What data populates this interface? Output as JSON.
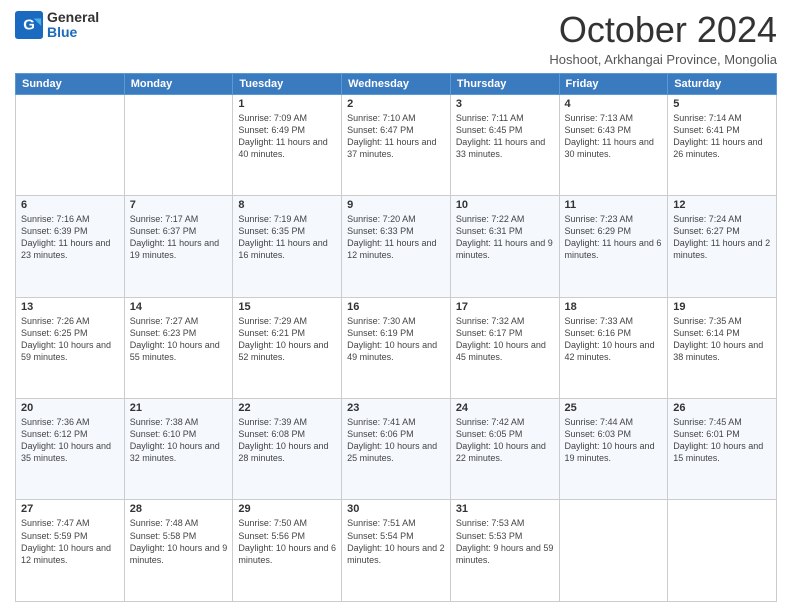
{
  "logo": {
    "general": "General",
    "blue": "Blue"
  },
  "header": {
    "month": "October 2024",
    "location": "Hoshoot, Arkhangai Province, Mongolia"
  },
  "days_of_week": [
    "Sunday",
    "Monday",
    "Tuesday",
    "Wednesday",
    "Thursday",
    "Friday",
    "Saturday"
  ],
  "weeks": [
    [
      {
        "day": "",
        "detail": ""
      },
      {
        "day": "",
        "detail": ""
      },
      {
        "day": "1",
        "detail": "Sunrise: 7:09 AM\nSunset: 6:49 PM\nDaylight: 11 hours and 40 minutes."
      },
      {
        "day": "2",
        "detail": "Sunrise: 7:10 AM\nSunset: 6:47 PM\nDaylight: 11 hours and 37 minutes."
      },
      {
        "day": "3",
        "detail": "Sunrise: 7:11 AM\nSunset: 6:45 PM\nDaylight: 11 hours and 33 minutes."
      },
      {
        "day": "4",
        "detail": "Sunrise: 7:13 AM\nSunset: 6:43 PM\nDaylight: 11 hours and 30 minutes."
      },
      {
        "day": "5",
        "detail": "Sunrise: 7:14 AM\nSunset: 6:41 PM\nDaylight: 11 hours and 26 minutes."
      }
    ],
    [
      {
        "day": "6",
        "detail": "Sunrise: 7:16 AM\nSunset: 6:39 PM\nDaylight: 11 hours and 23 minutes."
      },
      {
        "day": "7",
        "detail": "Sunrise: 7:17 AM\nSunset: 6:37 PM\nDaylight: 11 hours and 19 minutes."
      },
      {
        "day": "8",
        "detail": "Sunrise: 7:19 AM\nSunset: 6:35 PM\nDaylight: 11 hours and 16 minutes."
      },
      {
        "day": "9",
        "detail": "Sunrise: 7:20 AM\nSunset: 6:33 PM\nDaylight: 11 hours and 12 minutes."
      },
      {
        "day": "10",
        "detail": "Sunrise: 7:22 AM\nSunset: 6:31 PM\nDaylight: 11 hours and 9 minutes."
      },
      {
        "day": "11",
        "detail": "Sunrise: 7:23 AM\nSunset: 6:29 PM\nDaylight: 11 hours and 6 minutes."
      },
      {
        "day": "12",
        "detail": "Sunrise: 7:24 AM\nSunset: 6:27 PM\nDaylight: 11 hours and 2 minutes."
      }
    ],
    [
      {
        "day": "13",
        "detail": "Sunrise: 7:26 AM\nSunset: 6:25 PM\nDaylight: 10 hours and 59 minutes."
      },
      {
        "day": "14",
        "detail": "Sunrise: 7:27 AM\nSunset: 6:23 PM\nDaylight: 10 hours and 55 minutes."
      },
      {
        "day": "15",
        "detail": "Sunrise: 7:29 AM\nSunset: 6:21 PM\nDaylight: 10 hours and 52 minutes."
      },
      {
        "day": "16",
        "detail": "Sunrise: 7:30 AM\nSunset: 6:19 PM\nDaylight: 10 hours and 49 minutes."
      },
      {
        "day": "17",
        "detail": "Sunrise: 7:32 AM\nSunset: 6:17 PM\nDaylight: 10 hours and 45 minutes."
      },
      {
        "day": "18",
        "detail": "Sunrise: 7:33 AM\nSunset: 6:16 PM\nDaylight: 10 hours and 42 minutes."
      },
      {
        "day": "19",
        "detail": "Sunrise: 7:35 AM\nSunset: 6:14 PM\nDaylight: 10 hours and 38 minutes."
      }
    ],
    [
      {
        "day": "20",
        "detail": "Sunrise: 7:36 AM\nSunset: 6:12 PM\nDaylight: 10 hours and 35 minutes."
      },
      {
        "day": "21",
        "detail": "Sunrise: 7:38 AM\nSunset: 6:10 PM\nDaylight: 10 hours and 32 minutes."
      },
      {
        "day": "22",
        "detail": "Sunrise: 7:39 AM\nSunset: 6:08 PM\nDaylight: 10 hours and 28 minutes."
      },
      {
        "day": "23",
        "detail": "Sunrise: 7:41 AM\nSunset: 6:06 PM\nDaylight: 10 hours and 25 minutes."
      },
      {
        "day": "24",
        "detail": "Sunrise: 7:42 AM\nSunset: 6:05 PM\nDaylight: 10 hours and 22 minutes."
      },
      {
        "day": "25",
        "detail": "Sunrise: 7:44 AM\nSunset: 6:03 PM\nDaylight: 10 hours and 19 minutes."
      },
      {
        "day": "26",
        "detail": "Sunrise: 7:45 AM\nSunset: 6:01 PM\nDaylight: 10 hours and 15 minutes."
      }
    ],
    [
      {
        "day": "27",
        "detail": "Sunrise: 7:47 AM\nSunset: 5:59 PM\nDaylight: 10 hours and 12 minutes."
      },
      {
        "day": "28",
        "detail": "Sunrise: 7:48 AM\nSunset: 5:58 PM\nDaylight: 10 hours and 9 minutes."
      },
      {
        "day": "29",
        "detail": "Sunrise: 7:50 AM\nSunset: 5:56 PM\nDaylight: 10 hours and 6 minutes."
      },
      {
        "day": "30",
        "detail": "Sunrise: 7:51 AM\nSunset: 5:54 PM\nDaylight: 10 hours and 2 minutes."
      },
      {
        "day": "31",
        "detail": "Sunrise: 7:53 AM\nSunset: 5:53 PM\nDaylight: 9 hours and 59 minutes."
      },
      {
        "day": "",
        "detail": ""
      },
      {
        "day": "",
        "detail": ""
      }
    ]
  ]
}
